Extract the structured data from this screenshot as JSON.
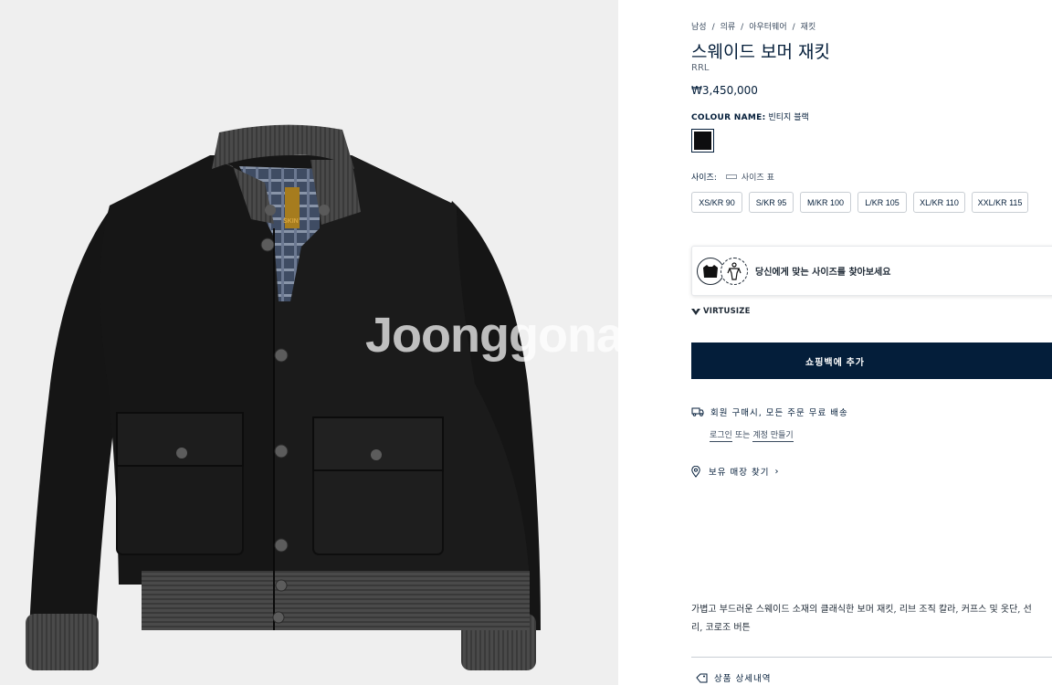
{
  "image": {
    "watermark": "Joonggonara",
    "label_text": "SKIN"
  },
  "breadcrumb": [
    "남성",
    "의류",
    "아우터웨어",
    "재킷"
  ],
  "breadcrumb_separator": "/",
  "product": {
    "title": "스웨이드 보머 재킷",
    "brand": "RRL",
    "price": "₩3,450,000"
  },
  "colour": {
    "label": "COLOUR NAME:",
    "value": "빈티지 블랙",
    "swatch_color": "#0d0d0f"
  },
  "size": {
    "label": "사이즈:",
    "guide_label": "사이즈 표",
    "options": [
      "XS/KR 90",
      "S/KR 95",
      "M/KR 100",
      "L/KR 105",
      "XL/KR 110",
      "XXL/KR 115"
    ]
  },
  "virtusize": {
    "prompt": "당신에게 맞는 사이즈를 찾아보세요",
    "brand": "VIRTUSIZE"
  },
  "add_to_bag": "쇼핑백에 추가",
  "shipping": {
    "text": "회원 구매시, 모든 주문 무료 배송",
    "login_link": "로그인",
    "or_text": "또는",
    "create_account_link": "계정 만들기"
  },
  "store_finder": "보유 매장 찾기",
  "store_finder_chevron": "›",
  "description": {
    "line1": "가볍고 부드러운 스웨이드 소재의 클래식한 보머 재킷, 리브 조직 칼라, 커프스 및 옷단, 선",
    "line2": "리, 코로조 버튼"
  },
  "details_label": "상품 상세내역",
  "colors": {
    "navy": "#041e3a",
    "image_bg": "#efefef",
    "jacket": "#141414",
    "rib": "#4a4a4a"
  }
}
